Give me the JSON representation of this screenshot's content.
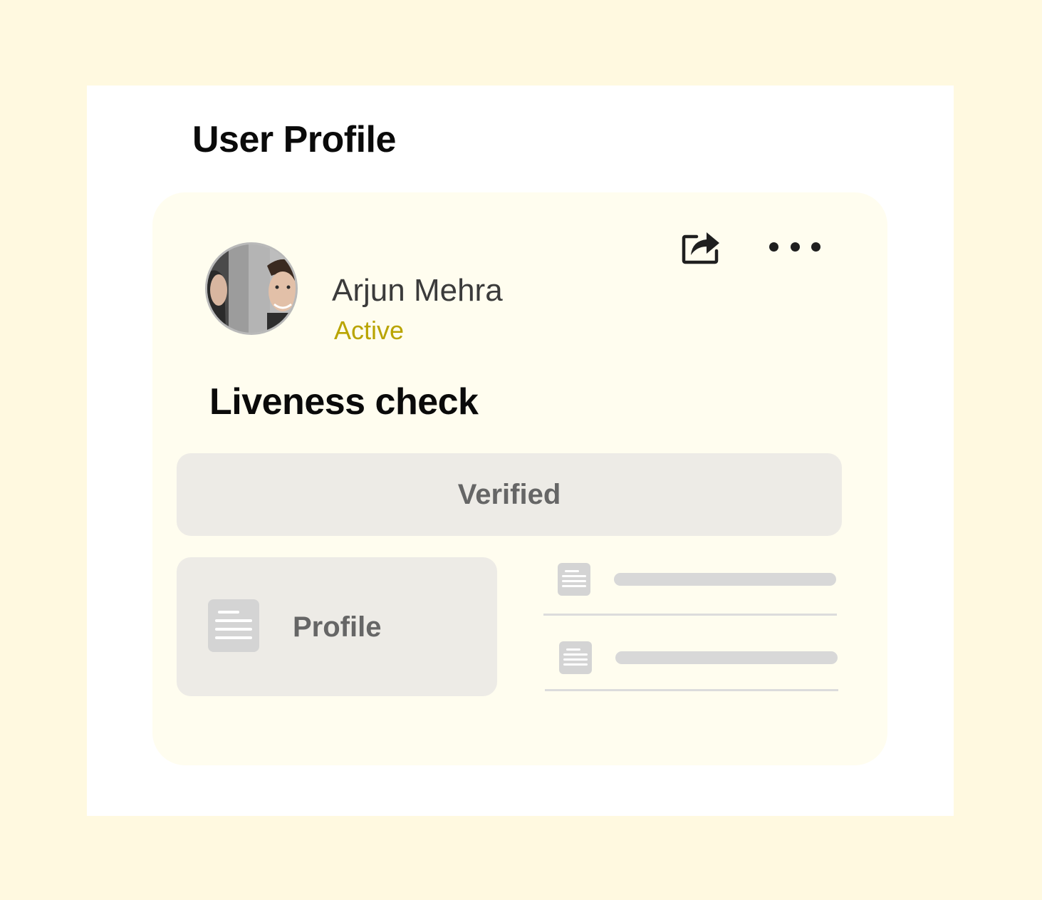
{
  "page": {
    "title": "User Profile"
  },
  "user": {
    "name": "Arjun Mehra",
    "status": "Active",
    "status_color": "#B9A400"
  },
  "actions": {
    "share_icon": "share-icon",
    "more_icon": "more-horizontal-icon"
  },
  "liveness": {
    "title": "Liveness check",
    "result": "Verified"
  },
  "documents": {
    "profile_label": "Profile",
    "rows": [
      {
        "icon": "document-icon"
      },
      {
        "icon": "document-icon"
      }
    ]
  },
  "colors": {
    "page_background": "#FFF9E0",
    "panel_background": "#FFFFFF",
    "card_background": "#FFFDEF",
    "tile_background": "#EDEBE6",
    "skeleton": "#D8D8D8"
  }
}
